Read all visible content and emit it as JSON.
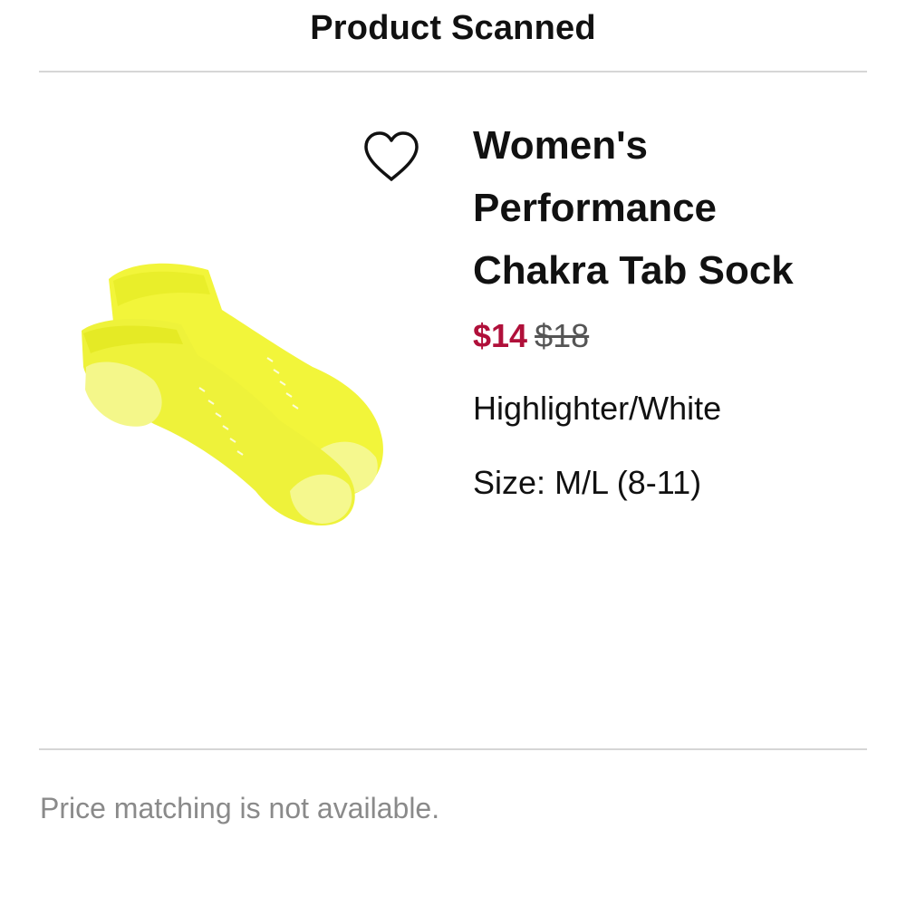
{
  "header": {
    "title": "Product Scanned"
  },
  "product": {
    "title_lines": [
      "Women's",
      "Performance",
      "Chakra Tab Sock"
    ],
    "sale_price": "$14",
    "original_price": "$18",
    "color": "Highlighter/White",
    "size_label": "Size:",
    "size_value": "M/L (8-11)",
    "favorite_icon": "heart-outline-icon",
    "image_subject": "yellow ankle socks"
  },
  "footer": {
    "note": "Price matching is not available."
  },
  "colors": {
    "sale_price": "#b0103a",
    "original_price": "#555555",
    "footer_text": "#8a8a8a",
    "divider": "#d6d6d6",
    "sock_yellow": "#f2f53a"
  }
}
